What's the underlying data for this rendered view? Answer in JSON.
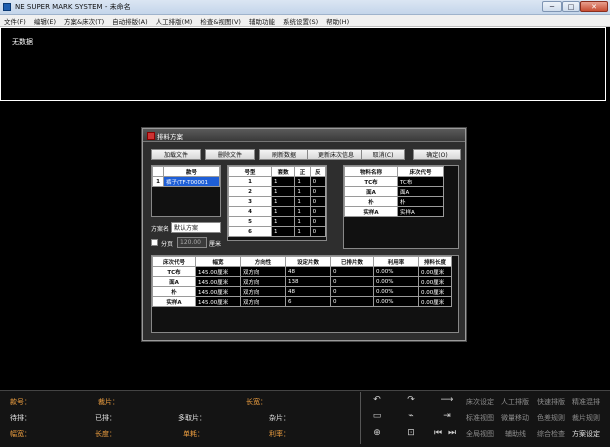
{
  "window": {
    "title": "NE SUPER MARK SYSTEM - 未命名",
    "min_label": "─",
    "max_label": "□",
    "close_label": "✕"
  },
  "menu": [
    "文件(F)",
    "编辑(E)",
    "方案&床次(T)",
    "自动排版(A)",
    "人工排版(M)",
    "检查&视图(V)",
    "辅助功能",
    "系统设置(S)",
    "帮助(H)"
  ],
  "canvas": {
    "empty_text": "无数据"
  },
  "dialog": {
    "title": "排料方案",
    "buttons": {
      "load": "加载文件",
      "delete": "删除文件",
      "refresh": "刷新数据",
      "update": "更新床次信息",
      "cancel": "取消(C)",
      "ok": "确定(O)"
    },
    "files_header": "款号",
    "files": [
      {
        "index": "1",
        "name": "裤子(TF-T00001"
      }
    ],
    "sizes_headers": [
      "号型",
      "套数",
      "正",
      "反"
    ],
    "sizes": [
      [
        "1",
        "1",
        "1",
        "0"
      ],
      [
        "2",
        "1",
        "1",
        "0"
      ],
      [
        "3",
        "1",
        "1",
        "0"
      ],
      [
        "4",
        "1",
        "1",
        "0"
      ],
      [
        "5",
        "1",
        "1",
        "0"
      ],
      [
        "6",
        "1",
        "1",
        "0"
      ]
    ],
    "materials_headers": [
      "物料名称",
      "床次代号"
    ],
    "materials": [
      [
        "TC布",
        "TC布"
      ],
      [
        "面A",
        "面A"
      ],
      [
        "朴",
        "朴"
      ],
      [
        "实样A",
        "实样A"
      ]
    ],
    "scheme_label": "方案名",
    "scheme_value": "默认方案",
    "split_label": "分页",
    "split_value": "120.00",
    "split_unit": "厘米",
    "beds_headers": [
      "床次代号",
      "幅宽",
      "方向性",
      "设定片数",
      "已排片数",
      "利用率",
      "排料长度"
    ],
    "beds": [
      [
        "TC布",
        "145.00厘米",
        "双方向",
        "48",
        "0",
        "0.00%",
        "0.00厘米"
      ],
      [
        "面A",
        "145.00厘米",
        "双方向",
        "138",
        "0",
        "0.00%",
        "0.00厘米"
      ],
      [
        "朴",
        "145.00厘米",
        "双方向",
        "48",
        "0",
        "0.00%",
        "0.00厘米"
      ],
      [
        "实样A",
        "145.00厘米",
        "双方向",
        "6",
        "0",
        "0.00%",
        "0.00厘米"
      ]
    ]
  },
  "status": {
    "row1": [
      "款号：",
      "裁片：",
      "长宽："
    ],
    "row2": [
      "待排：",
      "已排：",
      "多取片：",
      "杂片："
    ],
    "row3": [
      "幅宽：",
      "长度：",
      "单耗：",
      "利率："
    ]
  },
  "tools": {
    "row1": [
      "床次设定",
      "人工排版",
      "快速排版",
      "精准混排"
    ],
    "row2": [
      "标准视图",
      "微量移动",
      "色差规则",
      "裁片规则"
    ],
    "row3": [
      "全局视图",
      "辅助线",
      "综合检查",
      "方案设定"
    ]
  },
  "icons": [
    "undo-icon",
    "redo-icon",
    "arrow-right-icon",
    "bed-icon",
    "mark-icon",
    "zoom-icon",
    "scale-icon",
    "nav-first-icon",
    "nav-last-icon"
  ],
  "colors": {
    "status_label": "#f0a040",
    "status_text": "#e6e6e6",
    "tool_inactive": "#8d8d8d"
  }
}
